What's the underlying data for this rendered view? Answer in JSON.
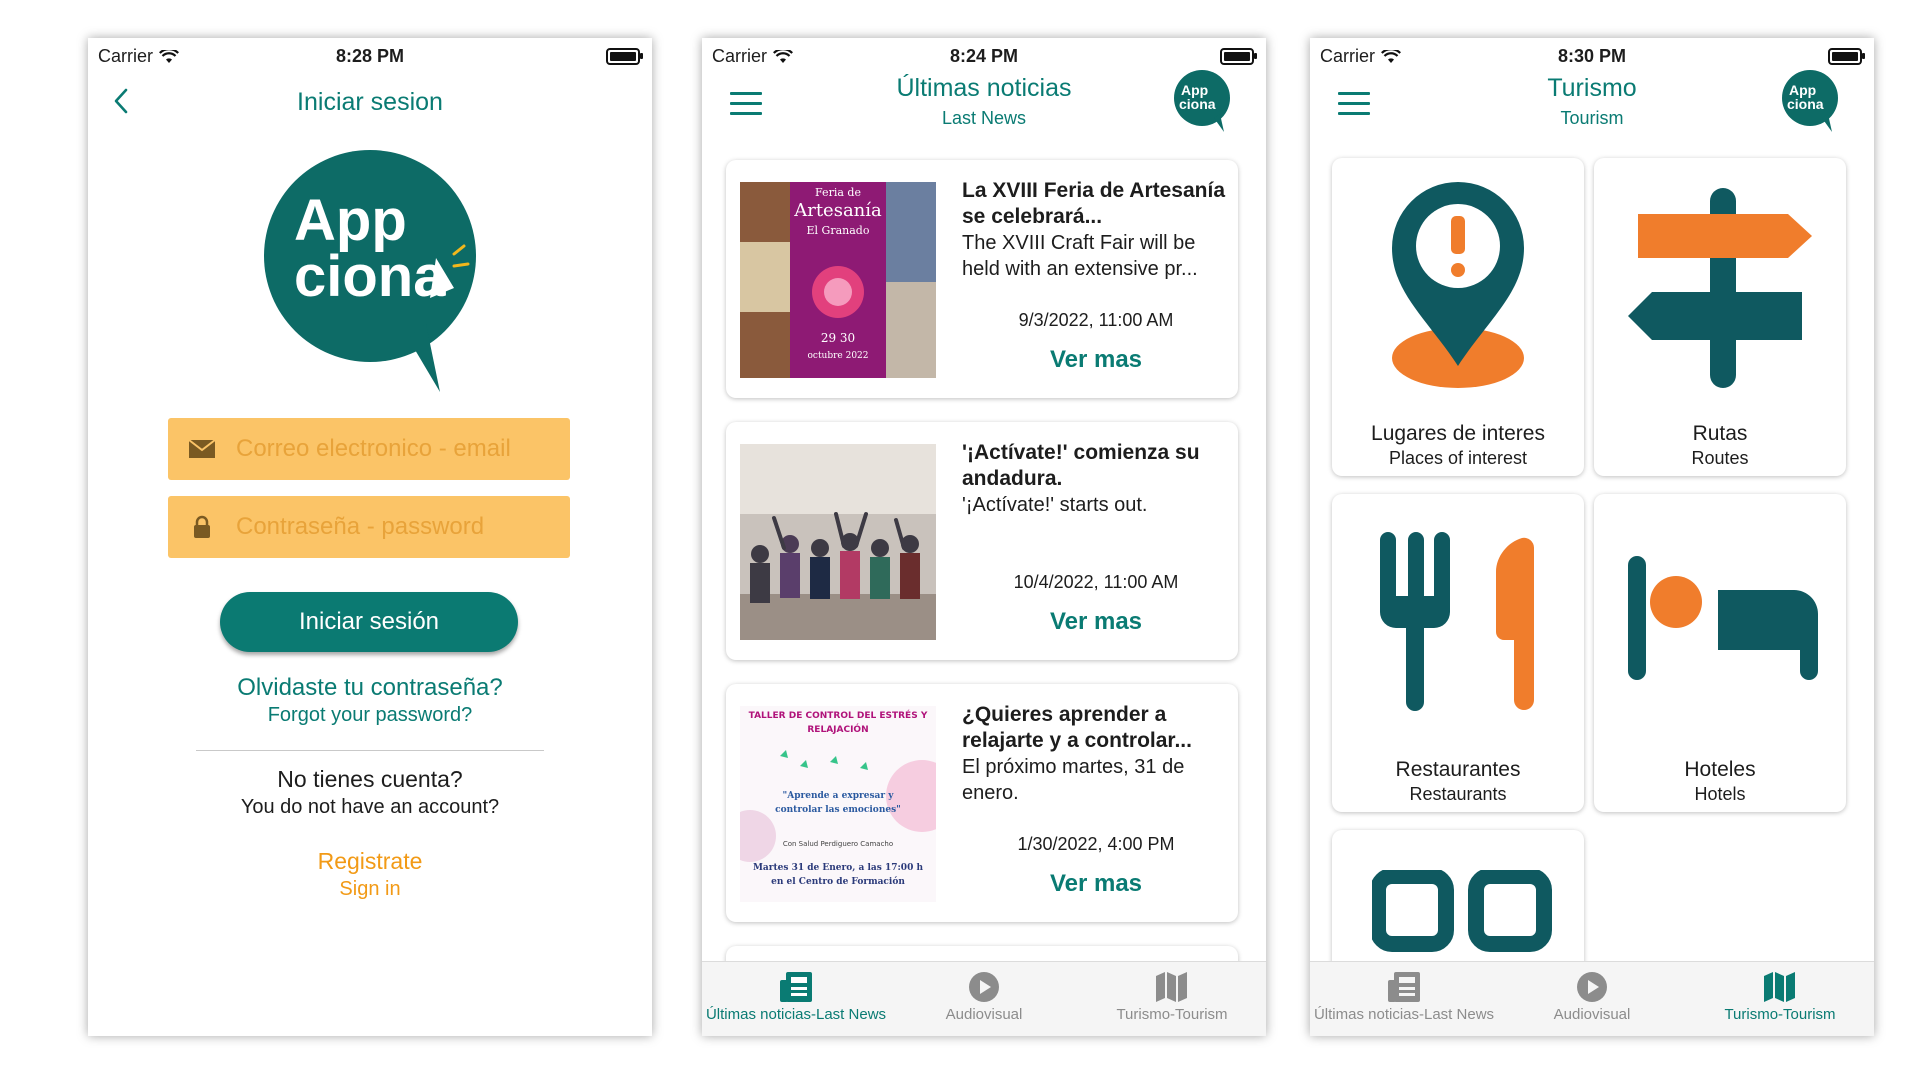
{
  "status": {
    "carrier": "Carrier"
  },
  "screen1": {
    "time": "8:28 PM",
    "title": "Iniciar sesion",
    "logo_text": [
      "App",
      "ciona"
    ],
    "email_placeholder": "Correo electronico - email",
    "password_placeholder": "Contraseña - password",
    "login_button": "Iniciar sesión",
    "forgot_es": "Olvidaste tu contraseña?",
    "forgot_en": "Forgot your password?",
    "no_account_es": "No tienes cuenta?",
    "no_account_en": "You do not have an account?",
    "register_es": "Registrate",
    "register_en": "Sign in"
  },
  "screen2": {
    "time": "8:24 PM",
    "title": "Últimas noticias",
    "subtitle": "Last News",
    "mini_logo_text": [
      "App",
      "ciona"
    ],
    "news": [
      {
        "title": "La XVIII Feria de Artesanía se celebrará...",
        "desc": "The XVIII Craft Fair will be held with an extensive pr...",
        "date": "9/3/2022, 11:00 AM",
        "more": "Ver mas",
        "poster_lines": [
          "Feria de",
          "Artesanía",
          "El Granado",
          "29 30",
          "octubre 2022"
        ]
      },
      {
        "title": "'¡Actívate!' comienza su andadura.",
        "desc": "'¡Actívate!' starts out.",
        "date": "10/4/2022, 11:00 AM",
        "more": "Ver mas"
      },
      {
        "title": "¿Quieres aprender a relajarte y a controlar...",
        "desc": "El próximo martes, 31 de enero.",
        "date": "1/30/2022, 4:00 PM",
        "more": "Ver mas",
        "poster_lines": [
          "TALLER DE CONTROL DEL ESTRÉS Y",
          "RELAJACIÓN",
          "\"Aprende a expresar y",
          "controlar las emociones\"",
          "Con Salud Perdiguero Camacho",
          "Martes 31 de Enero, a las 17:00 h",
          "en el Centro de Formación"
        ]
      }
    ]
  },
  "screen3": {
    "time": "8:30 PM",
    "title": "Turismo",
    "subtitle": "Tourism",
    "mini_logo_text": [
      "App",
      "ciona"
    ],
    "tiles": [
      {
        "label": "Lugares de interes",
        "sub": "Places of interest"
      },
      {
        "label": "Rutas",
        "sub": "Routes"
      },
      {
        "label": "Restaurantes",
        "sub": "Restaurants"
      },
      {
        "label": "Hoteles",
        "sub": "Hotels"
      }
    ]
  },
  "tabs": [
    {
      "label": "Últimas noticias-Last News",
      "icon": "news-icon"
    },
    {
      "label": "Audiovisual",
      "icon": "play-icon"
    },
    {
      "label": "Turismo-Tourism",
      "icon": "map-icon"
    }
  ],
  "colors": {
    "teal": "#0a7b73",
    "orange": "#f29a16",
    "field": "#fbc467",
    "tile_orange": "#f07d2c",
    "tile_teal": "#0f5960"
  }
}
